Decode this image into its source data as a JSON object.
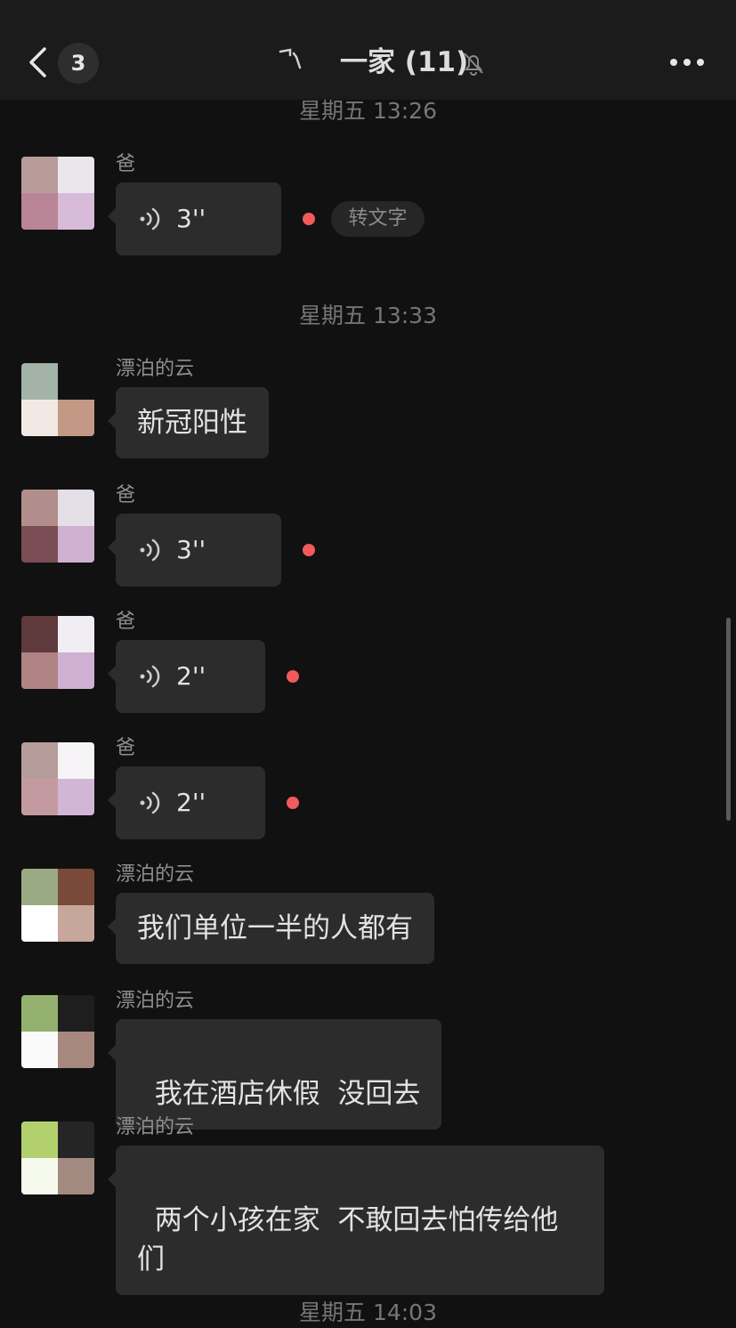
{
  "header": {
    "unread_count": "3",
    "title": "一家 (11)",
    "icons": [
      "back-icon",
      "chat-deco-icon",
      "mute-icon",
      "more-icon"
    ]
  },
  "timestamps": [
    "星期五 13:26",
    "星期五 13:33",
    "星期五 14:03"
  ],
  "messages": [
    {
      "sender": "爸",
      "type": "voice",
      "duration": "3''",
      "unread": true,
      "transcribe_label": "转文字"
    },
    {
      "sender": "漂泊的云",
      "type": "text",
      "text": "新冠阳性"
    },
    {
      "sender": "爸",
      "type": "voice",
      "duration": "3''",
      "unread": true
    },
    {
      "sender": "爸",
      "type": "voice",
      "duration": "2''",
      "unread": true
    },
    {
      "sender": "爸",
      "type": "voice",
      "duration": "2''",
      "unread": true
    },
    {
      "sender": "漂泊的云",
      "type": "text",
      "text": "我们单位一半的人都有"
    },
    {
      "sender": "漂泊的云",
      "type": "text",
      "text": "我在酒店休假  没回去"
    },
    {
      "sender": "漂泊的云",
      "type": "text",
      "text": "两个小孩在家  不敢回去怕传给他们"
    }
  ],
  "colors": {
    "background": "#111111",
    "header_background": "#1b1b1b",
    "bubble": "#2c2c2c",
    "unread_dot": "#f25b5b"
  }
}
